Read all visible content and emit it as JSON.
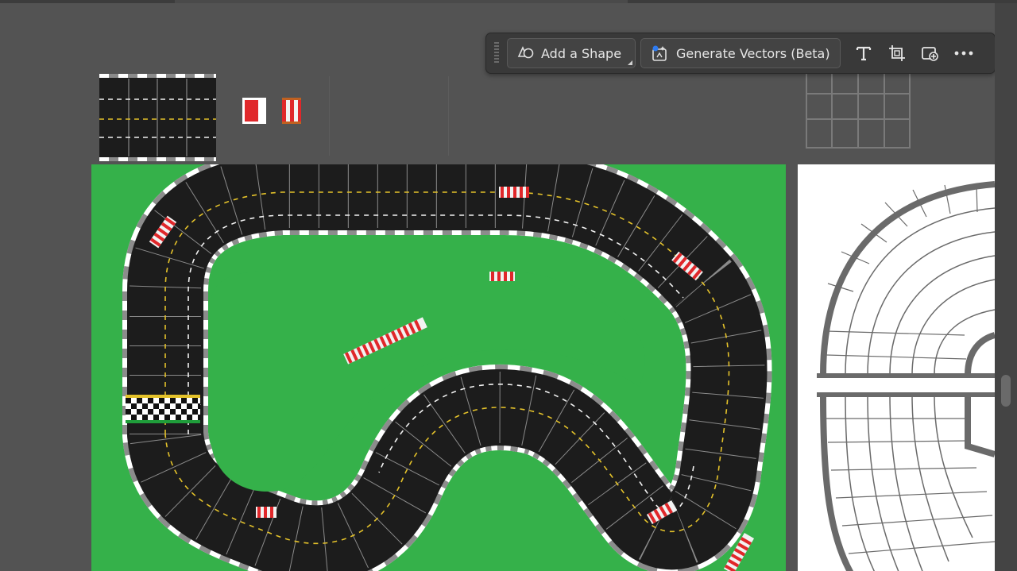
{
  "taskbar": {
    "add_shape_label": "Add a Shape",
    "generate_vectors_label": "Generate Vectors (Beta)",
    "icons": [
      "shape-icon",
      "generate-vectors-icon",
      "type-icon",
      "crop-icon",
      "add-image-icon",
      "more-icon"
    ]
  },
  "colors": {
    "canvas_bg": "#535353",
    "grass": "#35b14a",
    "track": "#1c1c1c",
    "curb_red": "#e0272a",
    "lane_dash": "#f2f2f2",
    "center_dash": "#e4c22a",
    "taskbar_bg": "#393939"
  }
}
